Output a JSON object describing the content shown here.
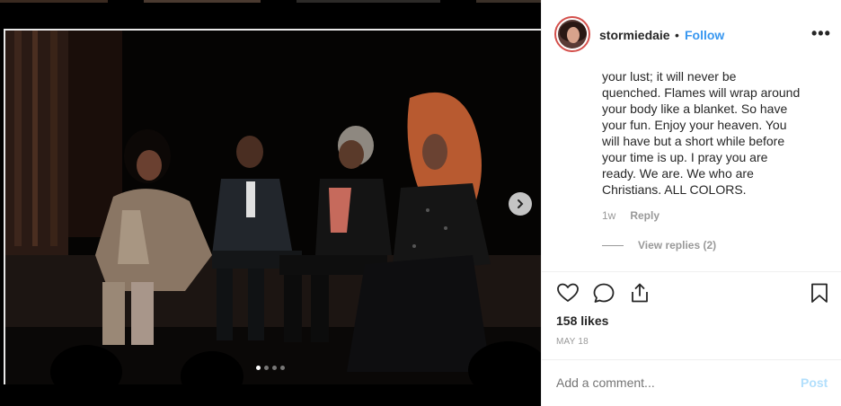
{
  "post": {
    "username": "stormiedaie",
    "bullet": "•",
    "follow_label": "Follow",
    "more_label": "•••"
  },
  "comment": {
    "lines": [
      "your lust; it will never be",
      "quenched. Flames will wrap around",
      "your body like a blanket. So have",
      "your fun. Enjoy your heaven. You",
      "will have but a short while before",
      "your time is up. I pray you are",
      "ready. We are. We who are",
      "Christians. ALL COLORS."
    ],
    "age": "1w",
    "reply_label": "Reply",
    "view_replies_label": "View replies (2)"
  },
  "engagement": {
    "likes": "158 likes",
    "date": "MAY 18"
  },
  "composer": {
    "placeholder": "Add a comment...",
    "post_label": "Post"
  },
  "carousel": {
    "slide_count": 4,
    "active_index": 0
  },
  "icons": {
    "like": "heart-icon",
    "comment": "comment-icon",
    "share": "share-icon",
    "save": "bookmark-icon",
    "next": "chevron-right-icon",
    "more": "more-options-icon"
  },
  "colors": {
    "follow": "#3897f0",
    "post_disabled": "#b2dffc",
    "text": "#262626",
    "muted": "#999999",
    "avatar_ring": "#d4504c"
  }
}
